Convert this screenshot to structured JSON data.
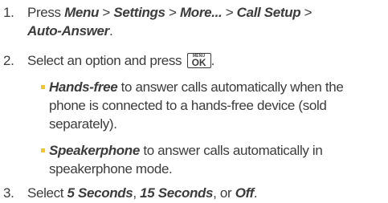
{
  "step1": {
    "number": "1.",
    "press": "Press ",
    "menu": "Menu",
    "sep1": " > ",
    "settings": "Settings",
    "sep2": " > ",
    "more": "More...",
    "sep3": " > ",
    "call_setup": "Call Setup",
    "sep4": " >",
    "auto_answer": "Auto-Answer",
    "end": "."
  },
  "step2": {
    "number": "2.",
    "text": "Select an option and press ",
    "key_top": "MENU",
    "key_main": "OK",
    "end": "."
  },
  "bullet1": {
    "term": "Hands-free",
    "line1": " to answer calls automatically when the",
    "line2": "phone is connected to a hands-free device (sold",
    "line3": "separately)."
  },
  "bullet2": {
    "term": "Speakerphone",
    "line1": " to answer calls automatically in",
    "line2": "speakerphone mode."
  },
  "step3": {
    "number": "3.",
    "select": "Select ",
    "opt1": "5 Seconds",
    "comma1": ", ",
    "opt2": "15 Seconds",
    "or": ", or ",
    "opt3": "Off",
    "end": "."
  },
  "colors": {
    "text": "#3c3c3c",
    "bullet": "#f2c61f"
  }
}
